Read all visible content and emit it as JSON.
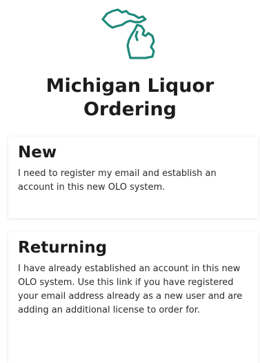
{
  "logo": {
    "icon": "michigan-state-outline-icon",
    "color": "#1e8a7a"
  },
  "title": "Michigan Liquor Ordering",
  "options": {
    "new": {
      "heading": "New",
      "description": "I need to register my email and establish an account in this new OLO system."
    },
    "returning": {
      "heading": "Returning",
      "description": "I have already established an account in this new OLO system. Use this link if you have registered your email address already as a new user and are adding an additional license to order for."
    }
  }
}
